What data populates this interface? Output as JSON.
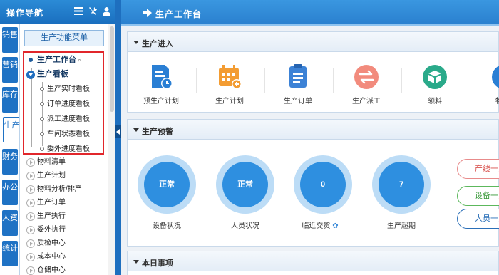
{
  "left": {
    "title": "操作导航",
    "header_icons": [
      "list-icon",
      "tools-icon",
      "user-icon"
    ],
    "menu_button": "生产功能菜单",
    "vtabs": [
      "销售",
      "营销",
      "库存",
      "生产",
      "财务",
      "办公",
      "人资",
      "统计"
    ],
    "active_vtab": "生产",
    "tree_highlight": [
      {
        "label": "生产工作台",
        "level": 0
      },
      {
        "label": "生产看板",
        "level": 0,
        "expanded": true
      },
      {
        "label": "生产实时看板",
        "level": 1
      },
      {
        "label": "订单进度看板",
        "level": 1
      },
      {
        "label": "派工进度看板",
        "level": 1
      },
      {
        "label": "车间状态看板",
        "level": 1
      },
      {
        "label": "委外进度看板",
        "level": 1
      }
    ],
    "tree_rest": [
      "物料清单",
      "生产计划",
      "物料分析/排产",
      "生产订单",
      "生产执行",
      "委外执行",
      "质检中心",
      "成本中心",
      "仓储中心"
    ]
  },
  "main": {
    "title": "生产工作台",
    "sections": {
      "entry": "生产进入",
      "warning": "生产预警",
      "today": "本日事项"
    },
    "functions": [
      {
        "label": "预生产计划",
        "icon": "pre-plan-icon",
        "color": "#2a7fd4"
      },
      {
        "label": "生产计划",
        "icon": "calendar-icon",
        "color": "#f39c32"
      },
      {
        "label": "生产订单",
        "icon": "clipboard-icon",
        "color": "#3c82d6"
      },
      {
        "label": "生产派工",
        "icon": "dispatch-icon",
        "color": "#f28b7d"
      },
      {
        "label": "领料",
        "icon": "box-icon",
        "color": "#2aaa8a"
      },
      {
        "label": "物",
        "icon": "material-icon",
        "color": "#2a7fd4"
      }
    ],
    "kpis": [
      {
        "value": "正常",
        "label": "设备状况"
      },
      {
        "value": "正常",
        "label": "人员状况"
      },
      {
        "value": "0",
        "label": "临近交货"
      },
      {
        "value": "7",
        "label": "生产超期"
      }
    ],
    "quick_buttons": [
      {
        "label": "产线一览",
        "color": "#e88b8b"
      },
      {
        "label": "设备一览",
        "color": "#5cb85c"
      },
      {
        "label": "人员一览",
        "color": "#2a6fb8"
      }
    ]
  }
}
